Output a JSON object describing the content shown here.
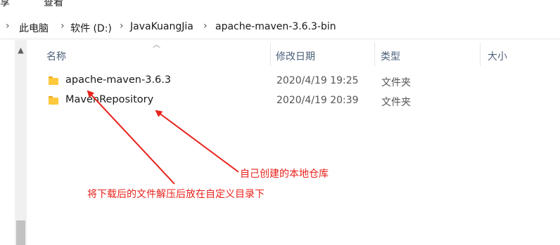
{
  "ribbon": {
    "tab_share": "共享",
    "tab_view": "查看"
  },
  "breadcrumb": {
    "items": [
      "此电脑",
      "软件 (D:)",
      "JavaKuangJia",
      "apache-maven-3.6.3-bin"
    ],
    "separator": "›",
    "expand_icon": "chevron-right-icon"
  },
  "columns": {
    "name": "名称",
    "date": "修改日期",
    "type": "类型",
    "size": "大小"
  },
  "files": [
    {
      "name": "apache-maven-3.6.3",
      "date": "2020/4/19 19:25",
      "type": "文件夹",
      "icon": "folder-icon"
    },
    {
      "name": "MavenRepository",
      "date": "2020/4/19 20:39",
      "type": "文件夹",
      "icon": "folder-icon"
    }
  ],
  "annotations": {
    "local_repo": "自己创建的本地仓库",
    "extract_note": "将下载后的文件解压后放在自定义目录下"
  },
  "colors": {
    "annotation": "#e8221c",
    "folder": "#ffc83d",
    "header_text": "#4c607a"
  }
}
